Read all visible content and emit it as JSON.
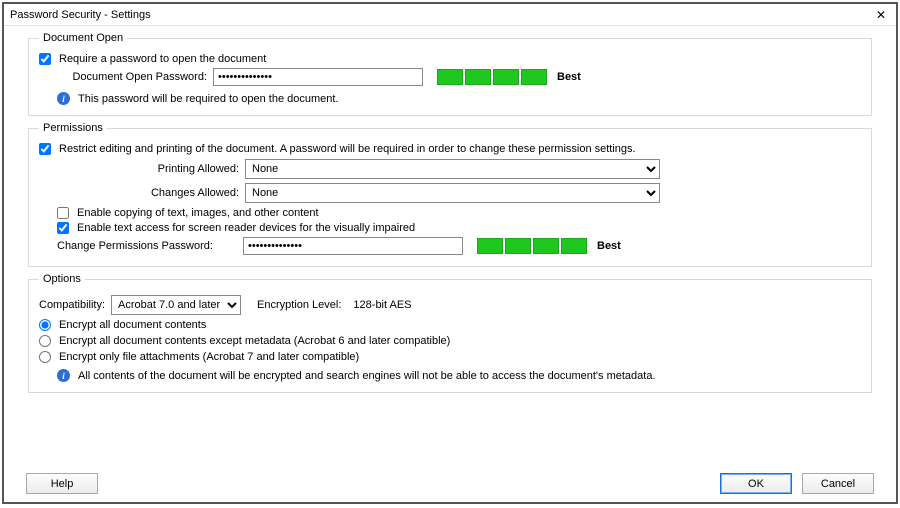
{
  "window": {
    "title": "Password Security - Settings",
    "close_label": "✕"
  },
  "document_open": {
    "legend": "Document Open",
    "require_password_label": "Require a password to open the document",
    "require_password_checked": true,
    "password_label": "Document Open Password:",
    "password_value": "**************",
    "strength_label": "Best",
    "info_text": "This password will be required to open the document."
  },
  "permissions": {
    "legend": "Permissions",
    "restrict_label": "Restrict editing and printing of the document. A password will be required in order to change these permission settings.",
    "restrict_checked": true,
    "printing_label": "Printing Allowed:",
    "printing_value": "None",
    "changes_label": "Changes Allowed:",
    "changes_value": "None",
    "copy_label": "Enable copying of text, images, and other content",
    "copy_checked": false,
    "screen_reader_label": "Enable text access for screen reader devices for the visually impaired",
    "screen_reader_checked": true,
    "change_pw_label": "Change Permissions Password:",
    "change_pw_value": "**************",
    "strength_label": "Best"
  },
  "options": {
    "legend": "Options",
    "compat_label": "Compatibility:",
    "compat_value": "Acrobat 7.0 and later",
    "enc_level_label": "Encryption  Level:",
    "enc_level_value": "128-bit AES",
    "enc_all_label": "Encrypt all document contents",
    "enc_except_label": "Encrypt all document contents except metadata (Acrobat 6 and later compatible)",
    "enc_attach_label": "Encrypt only file attachments (Acrobat 7 and later compatible)",
    "enc_selected": "all",
    "info_text": "All contents of the document will be encrypted and search engines will not be able to access the document's metadata."
  },
  "buttons": {
    "help": "Help",
    "ok": "OK",
    "cancel": "Cancel"
  }
}
